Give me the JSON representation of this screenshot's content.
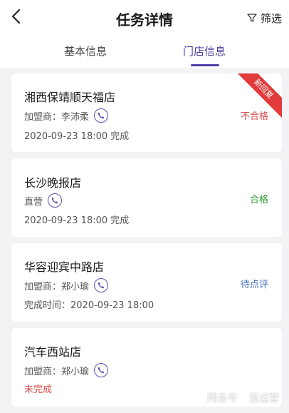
{
  "header": {
    "title": "任务详情",
    "filter_label": "筛选"
  },
  "tabs": [
    {
      "label": "基本信息",
      "active": false
    },
    {
      "label": "门店信息",
      "active": true
    }
  ],
  "colors": {
    "accent": "#4a3fa8",
    "fail": "#d94a4a",
    "pass": "#2f9a2f",
    "pending": "#3f6db8",
    "ribbon": "#e23b3b"
  },
  "stores": [
    {
      "name": "湘西保靖顺天福店",
      "owner": "加盟商：李沛柔",
      "meta": "2020-09-23 18:00 完成",
      "status": "不合格",
      "ribbon": "新回复"
    },
    {
      "name": "长沙晚报店",
      "owner": "直营",
      "meta": "2020-09-23 18:00 完成",
      "status": "合格"
    },
    {
      "name": "华容迎宾中路店",
      "owner": "加盟商：郑小瑜",
      "meta": "完成时间：2020-09-23 18:00",
      "status": "待点评"
    },
    {
      "name": "汽车西站店",
      "owner": "加盟商：郑小瑜",
      "meta": "未完成"
    }
  ],
  "watermark": {
    "left": "网易号",
    "right": "慧运营"
  }
}
